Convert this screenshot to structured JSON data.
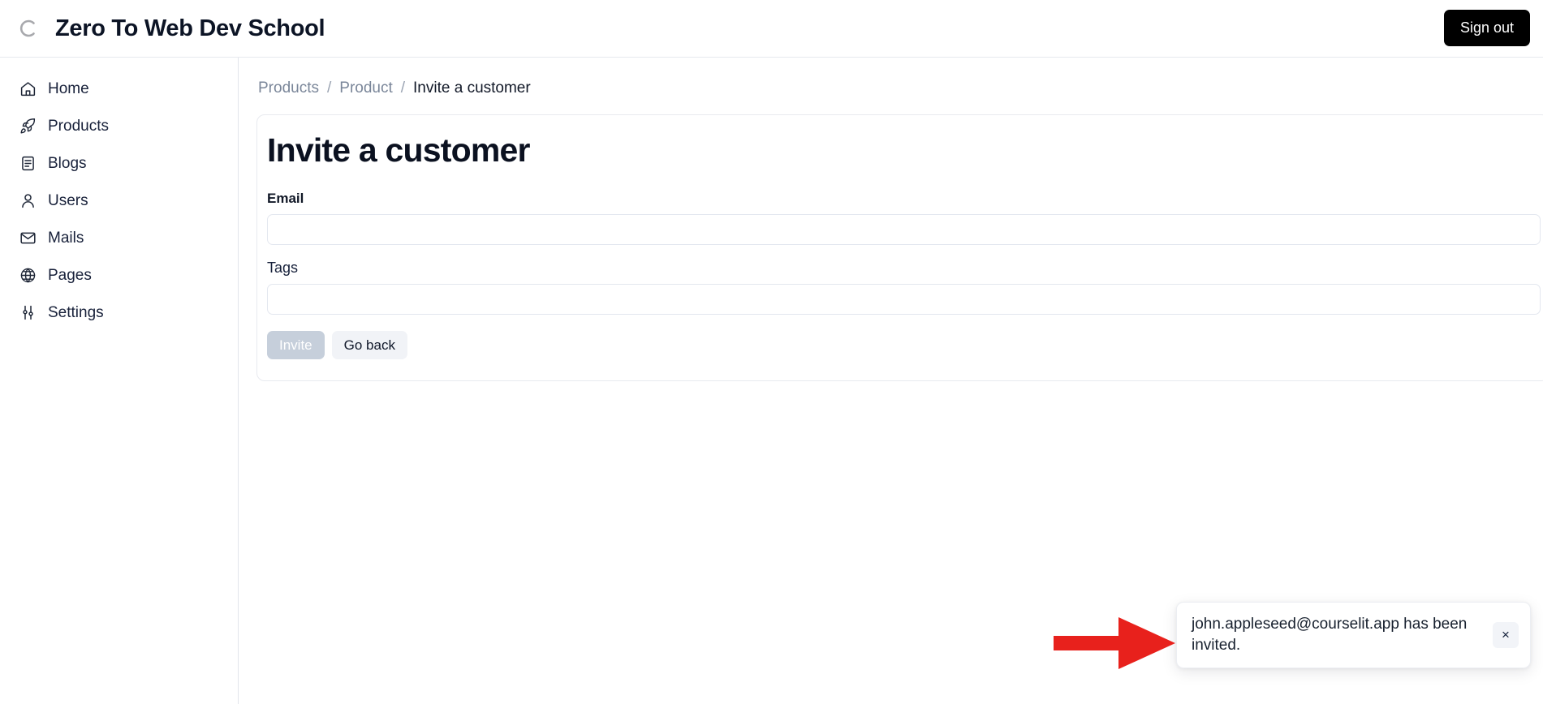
{
  "header": {
    "logo_icon": "courselit-c-logo-icon",
    "title": "Zero To Web Dev School",
    "signout_label": "Sign out"
  },
  "sidebar": {
    "items": [
      {
        "label": "Home",
        "icon": "home-icon"
      },
      {
        "label": "Products",
        "icon": "rocket-icon"
      },
      {
        "label": "Blogs",
        "icon": "file-text-icon"
      },
      {
        "label": "Users",
        "icon": "user-icon"
      },
      {
        "label": "Mails",
        "icon": "envelope-icon"
      },
      {
        "label": "Pages",
        "icon": "globe-icon"
      },
      {
        "label": "Settings",
        "icon": "sliders-icon"
      }
    ]
  },
  "breadcrumb": {
    "items": [
      {
        "label": "Products",
        "current": false
      },
      {
        "label": "Product",
        "current": false
      },
      {
        "label": "Invite a customer",
        "current": true
      }
    ],
    "separator": "/"
  },
  "card": {
    "title": "Invite a customer",
    "email_field": {
      "label": "Email",
      "value": "",
      "placeholder": ""
    },
    "tags_field": {
      "label": "Tags",
      "value": "",
      "placeholder": ""
    },
    "invite_button": {
      "label": "Invite",
      "disabled": true
    },
    "goback_button": {
      "label": "Go back"
    }
  },
  "toast": {
    "message": "john.appleseed@courselit.app has been invited.",
    "close_icon": "close-icon",
    "close_label": "×"
  },
  "annotation": {
    "arrow_icon": "right-arrow-annotation-icon",
    "color": "#e8211c"
  },
  "colors": {
    "accent_black": "#000000",
    "text_primary": "#0f1729",
    "text_muted": "#7a8699",
    "border": "#e8eaef",
    "disabled_button": "#c6cfdb",
    "secondary_button": "#f1f3f7",
    "annotation_red": "#e8211c"
  }
}
